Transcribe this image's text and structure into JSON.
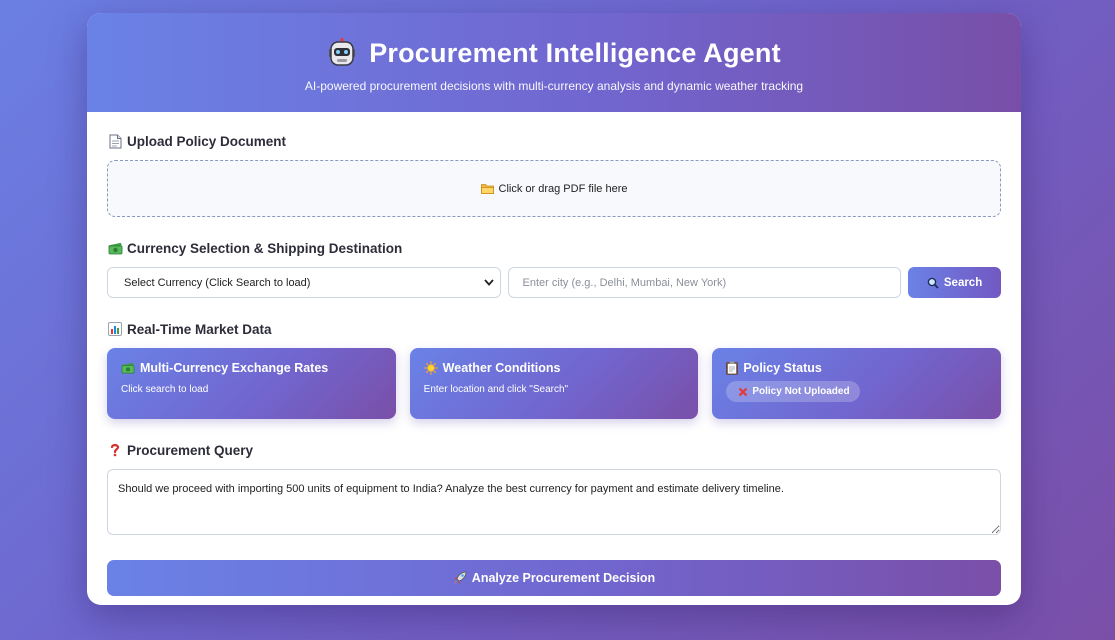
{
  "header": {
    "title": "Procurement Intelligence Agent",
    "subtitle": "AI-powered procurement decisions with multi-currency analysis and dynamic weather tracking",
    "icon": "robot-icon"
  },
  "upload": {
    "label": "Upload Policy Document",
    "label_icon": "document-icon",
    "dropzone_text": "Click or drag PDF file here",
    "dropzone_icon": "folder-icon"
  },
  "currency": {
    "label": "Currency Selection & Shipping Destination",
    "label_icon": "money-icon",
    "select_value": "Select Currency (Click Search to load)",
    "city_placeholder": "Enter city (e.g., Delhi, Mumbai, New York)",
    "search_label": "Search",
    "search_icon": "search-icon"
  },
  "market": {
    "label": "Real-Time Market Data",
    "label_icon": "bar-chart-icon",
    "cards": [
      {
        "title": "Multi-Currency Exchange Rates",
        "icon": "money-icon",
        "text": "Click search to load"
      },
      {
        "title": "Weather Conditions",
        "icon": "sun-icon",
        "text": "Enter location and click \"Search\""
      },
      {
        "title": "Policy Status",
        "icon": "clipboard-icon",
        "badge": "Policy Not Uploaded",
        "badge_icon": "cross-icon"
      }
    ]
  },
  "query": {
    "label": "Procurement Query",
    "label_icon": "question-icon",
    "value": "Should we proceed with importing 500 units of equipment to India? Analyze the best currency for payment and estimate delivery timeline."
  },
  "analyze": {
    "label": "Analyze Procurement Decision",
    "icon": "rocket-icon"
  },
  "colors": {
    "accent_start": "#6a82e6",
    "accent_end": "#7a4fa8",
    "badge_cross": "#e53935"
  }
}
